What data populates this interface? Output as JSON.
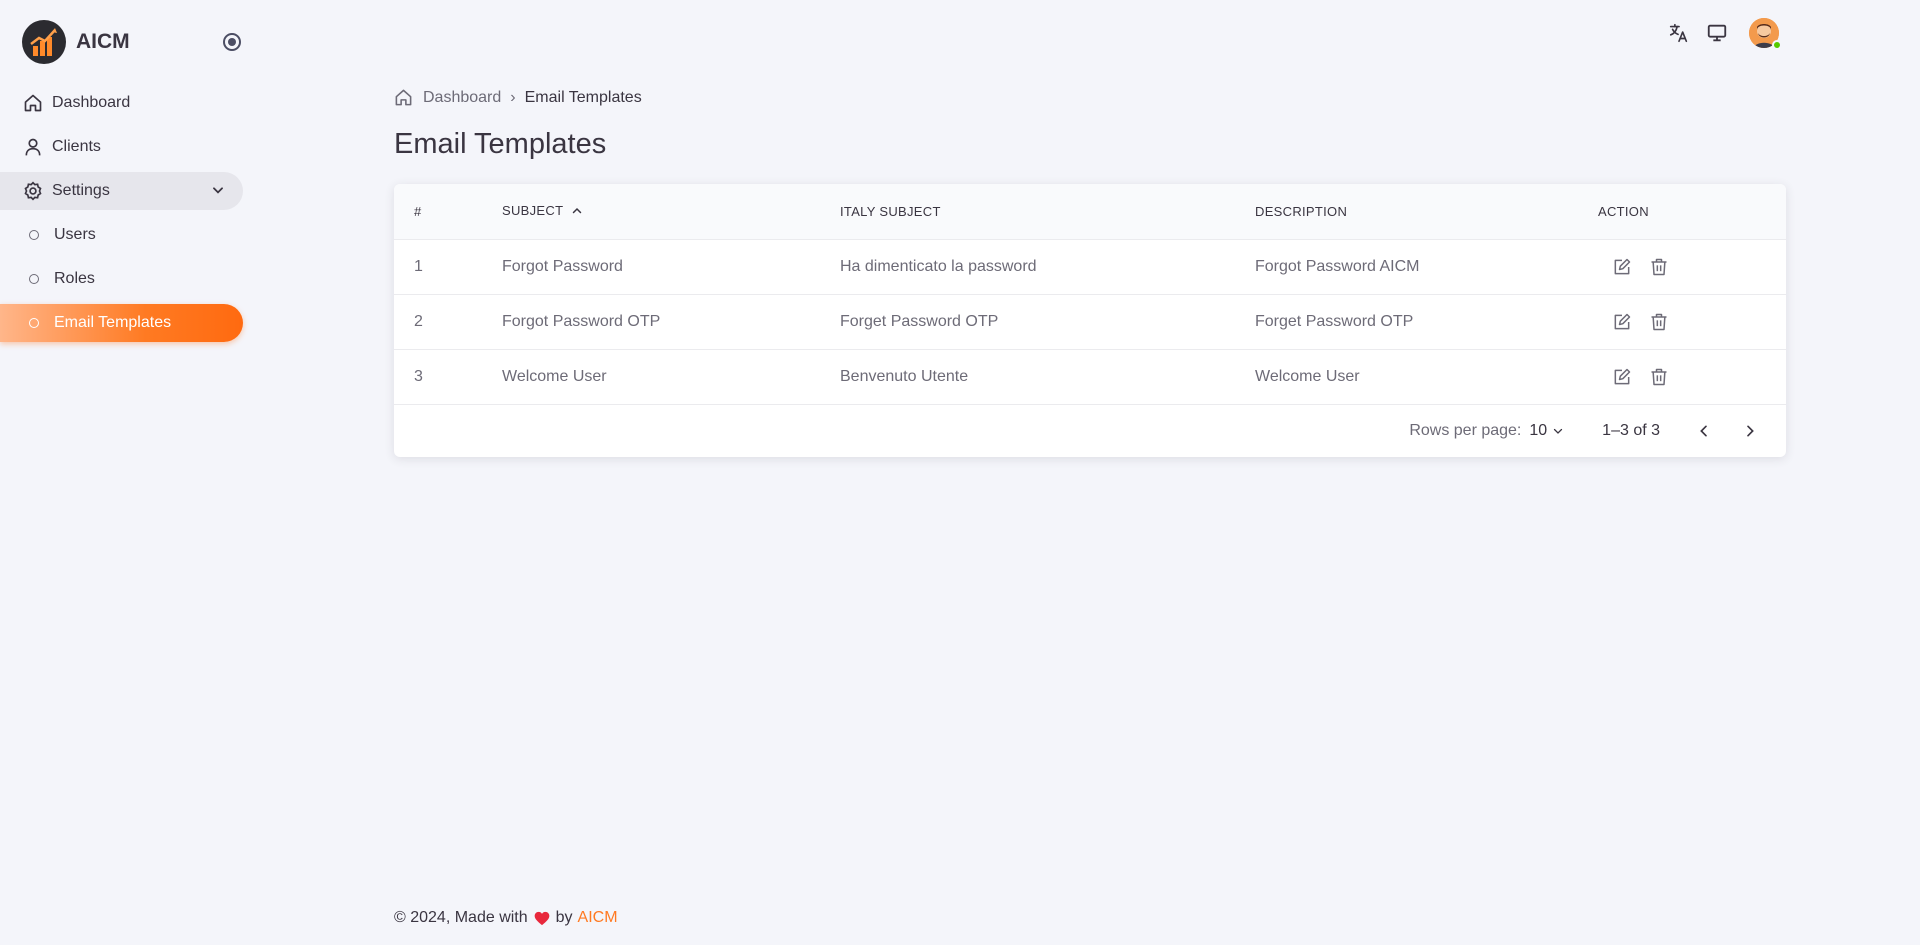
{
  "brand": {
    "name": "AICM"
  },
  "sidebar": {
    "items": [
      {
        "label": "Dashboard"
      },
      {
        "label": "Clients"
      },
      {
        "label": "Settings"
      }
    ],
    "settings_children": [
      {
        "label": "Users"
      },
      {
        "label": "Roles"
      },
      {
        "label": "Email Templates"
      }
    ]
  },
  "breadcrumb": {
    "home": "Dashboard",
    "separator": "›",
    "current": "Email Templates"
  },
  "page": {
    "title": "Email Templates"
  },
  "table": {
    "headers": [
      "#",
      "SUBJECT",
      "ITALY SUBJECT",
      "DESCRIPTION",
      "ACTION"
    ],
    "rows": [
      {
        "num": "1",
        "subject": "Forgot Password",
        "italy_subject": "Ha dimenticato la password",
        "description": "Forgot Password AICM"
      },
      {
        "num": "2",
        "subject": "Forgot Password OTP",
        "italy_subject": "Forget Password OTP",
        "description": "Forget Password OTP"
      },
      {
        "num": "3",
        "subject": "Welcome User",
        "italy_subject": "Benvenuto Utente",
        "description": "Welcome User"
      }
    ],
    "pagination": {
      "rows_per_page_label": "Rows per page:",
      "rows_per_page": "10",
      "range": "1–3 of 3"
    }
  },
  "footer": {
    "prefix": "© 2024, Made with",
    "by": "by",
    "brand": "AICM"
  },
  "colors": {
    "accent": "#ff7a22",
    "online": "#56ca00",
    "heart": "#e8283c"
  },
  "icons": [
    "logo",
    "radio-toggle-icon",
    "home-icon",
    "user-icon",
    "gear-icon",
    "chevron-down-icon",
    "circle-icon",
    "translate-icon",
    "monitor-icon",
    "avatar",
    "edit-icon",
    "trash-icon",
    "chevron-left-icon",
    "chevron-right-icon",
    "heart-icon",
    "sort-up-icon"
  ]
}
